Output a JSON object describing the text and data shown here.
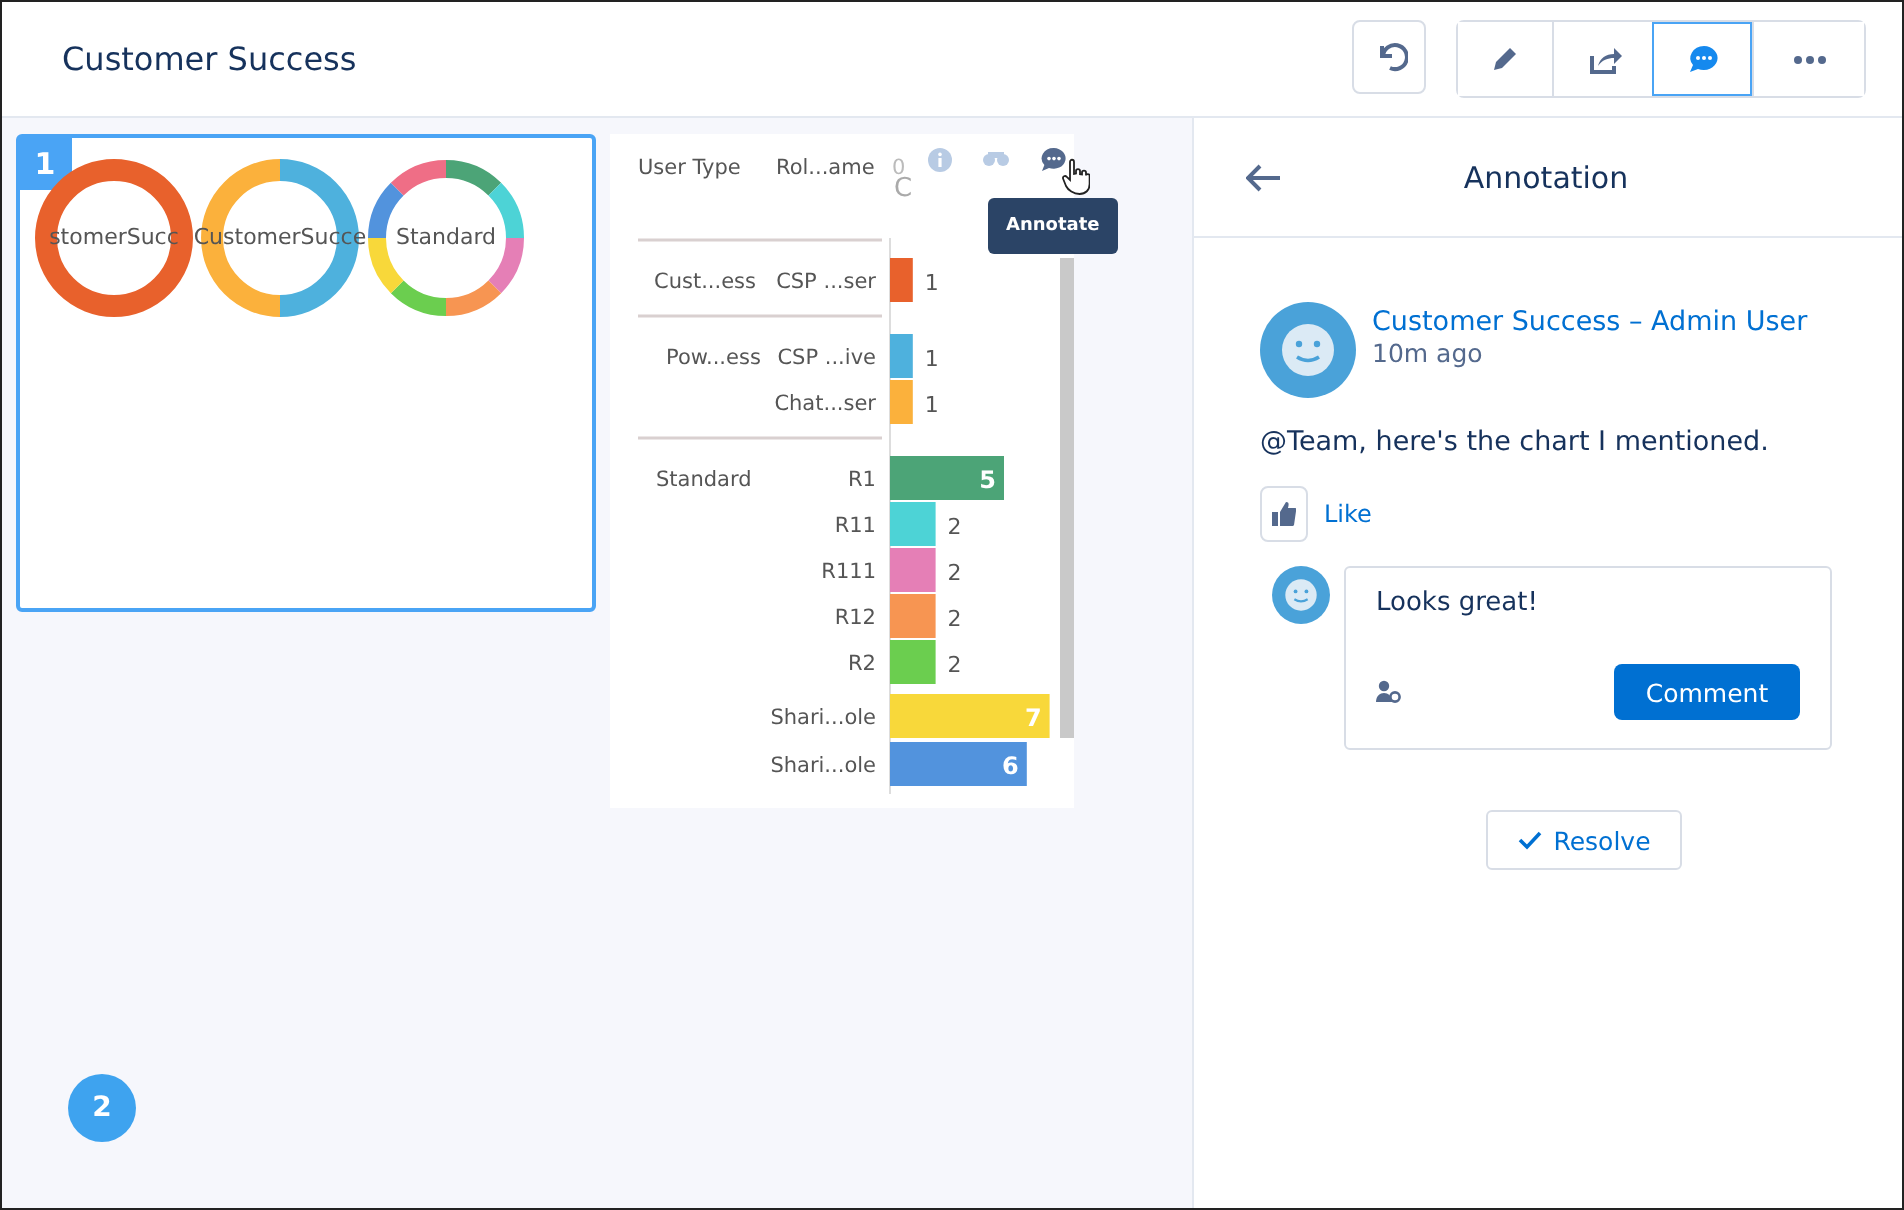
{
  "header": {
    "title": "Customer Success",
    "undo": {
      "kind": "undo"
    },
    "toolbar": [
      {
        "kind": "edit",
        "selected": false
      },
      {
        "kind": "share",
        "selected": false
      },
      {
        "kind": "annotate",
        "selected": true
      },
      {
        "kind": "more",
        "selected": false
      }
    ]
  },
  "canvas": {
    "widgets": [
      {
        "badge": "1",
        "selected": true,
        "donuts": [
          {
            "label": "stomerSucc",
            "segments": [
              {
                "color": "#e8612c"
              }
            ]
          },
          {
            "label": "CustomerSucce",
            "segments": [
              {
                "color": "#4eb1dd"
              },
              {
                "color": "#fbb13c"
              }
            ]
          },
          {
            "label": "Standard",
            "segments": [
              {
                "color": "#4ca477"
              },
              {
                "color": "#4dd3d6"
              },
              {
                "color": "#e57fb6"
              },
              {
                "color": "#f79552"
              },
              {
                "color": "#6bce4f"
              },
              {
                "color": "#f8d83a"
              },
              {
                "color": "#5293dd"
              },
              {
                "color": "#ef6e86"
              }
            ]
          }
        ]
      },
      {
        "badge": "2"
      }
    ],
    "bar_widget": {
      "axis_title": "C",
      "columns": [
        "User Type",
        "Rol...ame"
      ],
      "zero_label": "0",
      "tooltip": "Annotate",
      "groups": [
        {
          "user_type": "Cust...ess"
        },
        {
          "user_type": "Pow...ess"
        },
        {
          "user_type": "Standard"
        }
      ],
      "chart_data": {
        "type": "bar",
        "orientation": "horizontal",
        "categories": [
          "CSP ...ser",
          "CSP ...ive",
          "Chat...ser",
          "R1",
          "R11",
          "R111",
          "R12",
          "R2",
          "Shari...ole",
          "Shari...ole"
        ],
        "data_labels": true,
        "values": [
          1,
          1,
          1,
          5,
          2,
          2,
          2,
          2,
          7,
          6
        ],
        "colors": [
          "#e8612c",
          "#4eb1dd",
          "#fbb13c",
          "#4ca477",
          "#4dd3d6",
          "#e57fb6",
          "#f79552",
          "#6bce4f",
          "#f8d83a",
          "#5293dd"
        ]
      }
    }
  },
  "panel": {
    "title": "Annotation",
    "post": {
      "author": "Customer Success – Admin User",
      "time": "10m ago",
      "body": "@Team, here's the chart I mentioned.",
      "like": "Like"
    },
    "reply": {
      "value": "Looks great!",
      "button": "Comment"
    },
    "resolve": "Resolve"
  }
}
